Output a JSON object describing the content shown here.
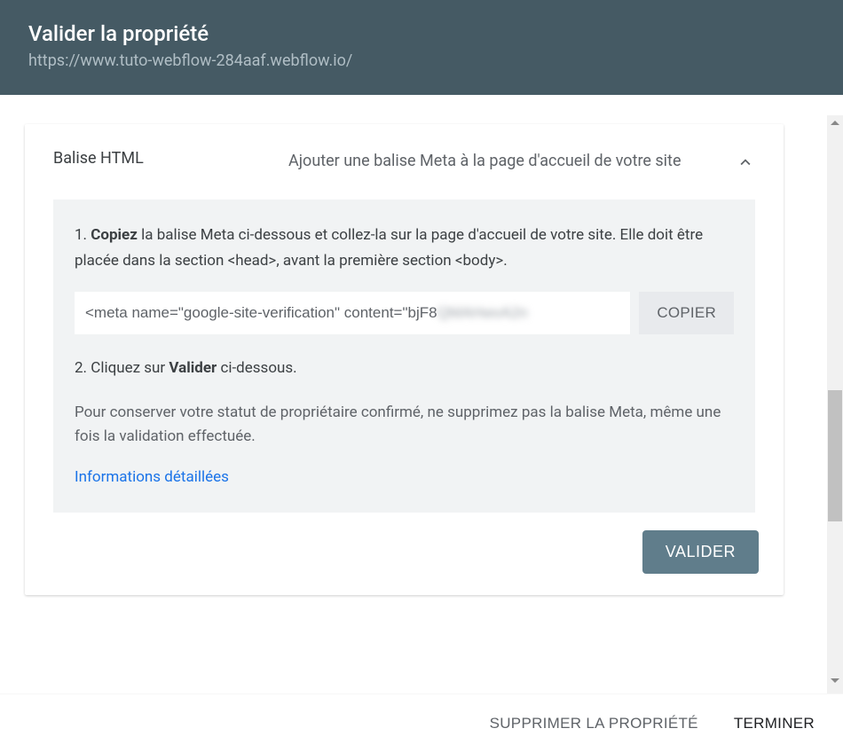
{
  "header": {
    "title": "Valider la propriété",
    "url": "https://www.tuto-webflow-284aaf.webflow.io/"
  },
  "panel": {
    "name": "Balise HTML",
    "description": "Ajouter une balise Meta à la page d'accueil de votre site"
  },
  "steps": {
    "step1_prefix": "1. ",
    "step1_bold": "Copiez",
    "step1_text_a": " la balise Meta ci-dessous et collez-la sur la page d'accueil de votre site. Elle doit être placée dans la section ",
    "head_tag": "<head>",
    "step1_text_b": ", avant la première section ",
    "body_tag": "<body>",
    "step1_text_c": ".",
    "meta_visible": "<meta name=\"google-site-verification\" content=\"bjF8",
    "meta_hidden": "QMAHwvA2n",
    "copy_label": "COPIER",
    "step2_prefix": "2. Cliquez sur ",
    "step2_bold": "Valider",
    "step2_suffix": " ci-dessous.",
    "note": "Pour conserver votre statut de propriétaire confirmé, ne supprimez pas la balise Meta, même une fois la validation effectuée.",
    "info_link": "Informations détaillées"
  },
  "actions": {
    "validate": "VALIDER",
    "delete": "SUPPRIMER LA PROPRIÉTÉ",
    "done": "TERMINER"
  }
}
